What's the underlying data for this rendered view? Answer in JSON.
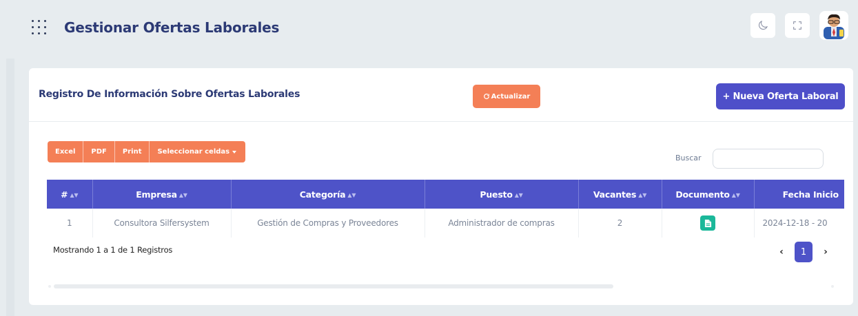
{
  "header": {
    "title": "Gestionar Ofertas Laborales",
    "menu_icon": "grid-dots-icon",
    "theme_icon": "moon-icon",
    "fullscreen_icon": "fullscreen-icon"
  },
  "card": {
    "title": "Registro De Información Sobre Ofertas Laborales",
    "refresh_label": "Actualizar",
    "new_label": "+ Nueva Oferta Laboral"
  },
  "toolbar": {
    "excel": "Excel",
    "pdf": "PDF",
    "print": "Print",
    "select_cells": "Seleccionar celdas"
  },
  "search": {
    "label": "Buscar",
    "value": "",
    "placeholder": ""
  },
  "table": {
    "columns": [
      "#",
      "Empresa",
      "Categoría",
      "Puesto",
      "Vacantes",
      "Documento",
      "Fecha Inicio"
    ],
    "rows": [
      {
        "num": "1",
        "empresa": "Consultora Silfersystem",
        "categoria": "Gestión de Compras y Proveedores",
        "puesto": "Administrador de compras",
        "vacantes": "2",
        "documento_icon": "document-icon",
        "fecha": "2024-12-18 - 20"
      }
    ]
  },
  "footer": {
    "info": "Mostrando 1 a 1 de 1 Registros",
    "page": "1",
    "prev": "‹",
    "next": "›"
  },
  "colors": {
    "primary": "#4e53c8",
    "accent": "#f47f56",
    "doc": "#1bb89a",
    "title": "#2c3a75"
  }
}
